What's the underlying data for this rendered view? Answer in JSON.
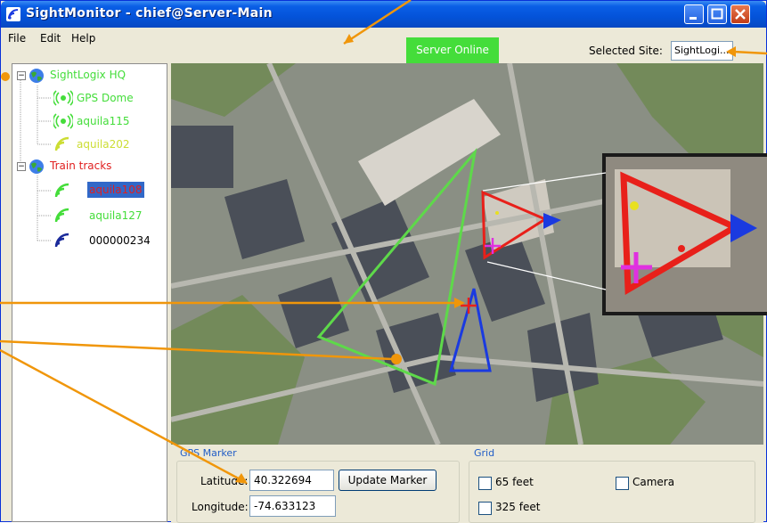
{
  "window": {
    "title": "SightMonitor - chief@Server-Main"
  },
  "menu": {
    "items": [
      "File",
      "Edit",
      "Help"
    ]
  },
  "status": {
    "server": "Server Online"
  },
  "site_selector": {
    "label": "Selected Site:",
    "value": "SightLogi..."
  },
  "tree": {
    "sites": [
      {
        "name": "SightLogix HQ",
        "color": "#44dd3a",
        "expanded": true,
        "devices": [
          {
            "name": "GPS Dome",
            "color": "#44dd3a",
            "icon": "dome-sensor-icon",
            "selected": false
          },
          {
            "name": "aquila115",
            "color": "#44dd3a",
            "icon": "dome-sensor-icon",
            "selected": false
          },
          {
            "name": "aquila202",
            "color": "#ccdd33",
            "icon": "camera-signal-icon",
            "selected": false
          }
        ]
      },
      {
        "name": "Train tracks",
        "color": "#e02020",
        "expanded": true,
        "devices": [
          {
            "name": "aquila108",
            "color": "#e02020",
            "icon": "camera-signal-icon",
            "selected": true
          },
          {
            "name": "aquila127",
            "color": "#44dd3a",
            "icon": "camera-signal-icon",
            "selected": false
          },
          {
            "name": "000000234",
            "color": "#000000",
            "icon": "camera-signal-icon",
            "selected": false
          }
        ]
      }
    ]
  },
  "gps_marker": {
    "title": "GPS Marker",
    "latitude_label": "Latitude:",
    "latitude_value": "40.322694",
    "longitude_label": "Longitude:",
    "longitude_value": "-74.633123",
    "update_button": "Update Marker"
  },
  "grid": {
    "title": "Grid",
    "options": [
      {
        "label": "65 feet",
        "checked": false
      },
      {
        "label": "Camera",
        "checked": false
      },
      {
        "label": "325 feet",
        "checked": false
      }
    ]
  },
  "colors": {
    "green_zone": "#5ed94a",
    "blue_zone": "#1a3ae0",
    "red_zone": "#e8201a",
    "callout": "#f0960a",
    "marker_pink": "#e030e0"
  }
}
